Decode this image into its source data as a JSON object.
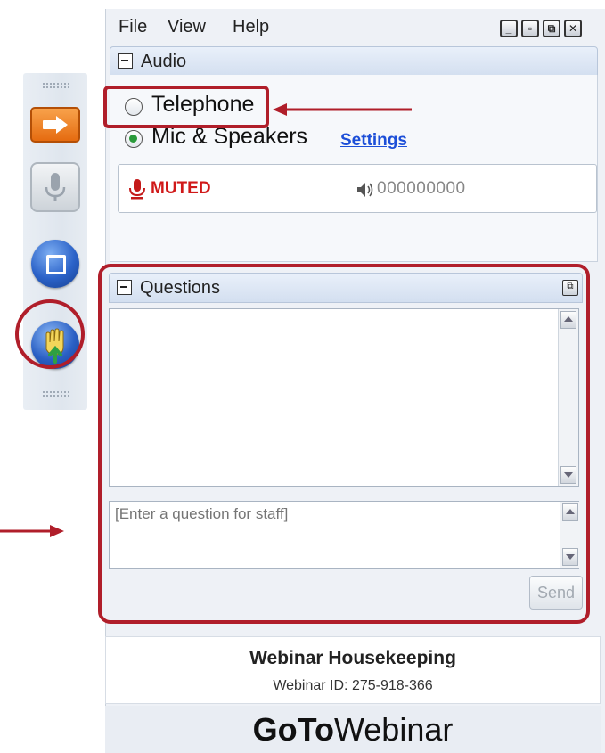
{
  "menubar": {
    "items": [
      "File",
      "View",
      "Help"
    ]
  },
  "window_controls": {
    "minimize": "_",
    "restore": "▫",
    "popout": "⧉",
    "close": "✕"
  },
  "audio": {
    "title": "Audio",
    "options": [
      "Telephone",
      "Mic & Speakers"
    ],
    "selected": "Mic & Speakers",
    "settings_link": "Settings",
    "mute_status": "MUTED",
    "level_meter": "000000000"
  },
  "questions": {
    "title": "Questions",
    "input_placeholder": "[Enter a question for staff]",
    "send_label": "Send"
  },
  "info": {
    "title": "Webinar Housekeeping",
    "webinar_id": "Webinar ID: 275-918-366"
  },
  "brand": {
    "bold": "GoTo",
    "light": "Webinar"
  },
  "icons": {
    "arrow": "arrow-right-icon",
    "mic": "microphone-icon",
    "screen": "screen-icon",
    "hand": "raise-hand-icon",
    "speaker": "speaker-icon"
  },
  "colors": {
    "annotation_red": "#b01e2a",
    "muted_red": "#d01919",
    "link_blue": "#1d4fd8",
    "toolbar_orange": "#e56b10"
  }
}
